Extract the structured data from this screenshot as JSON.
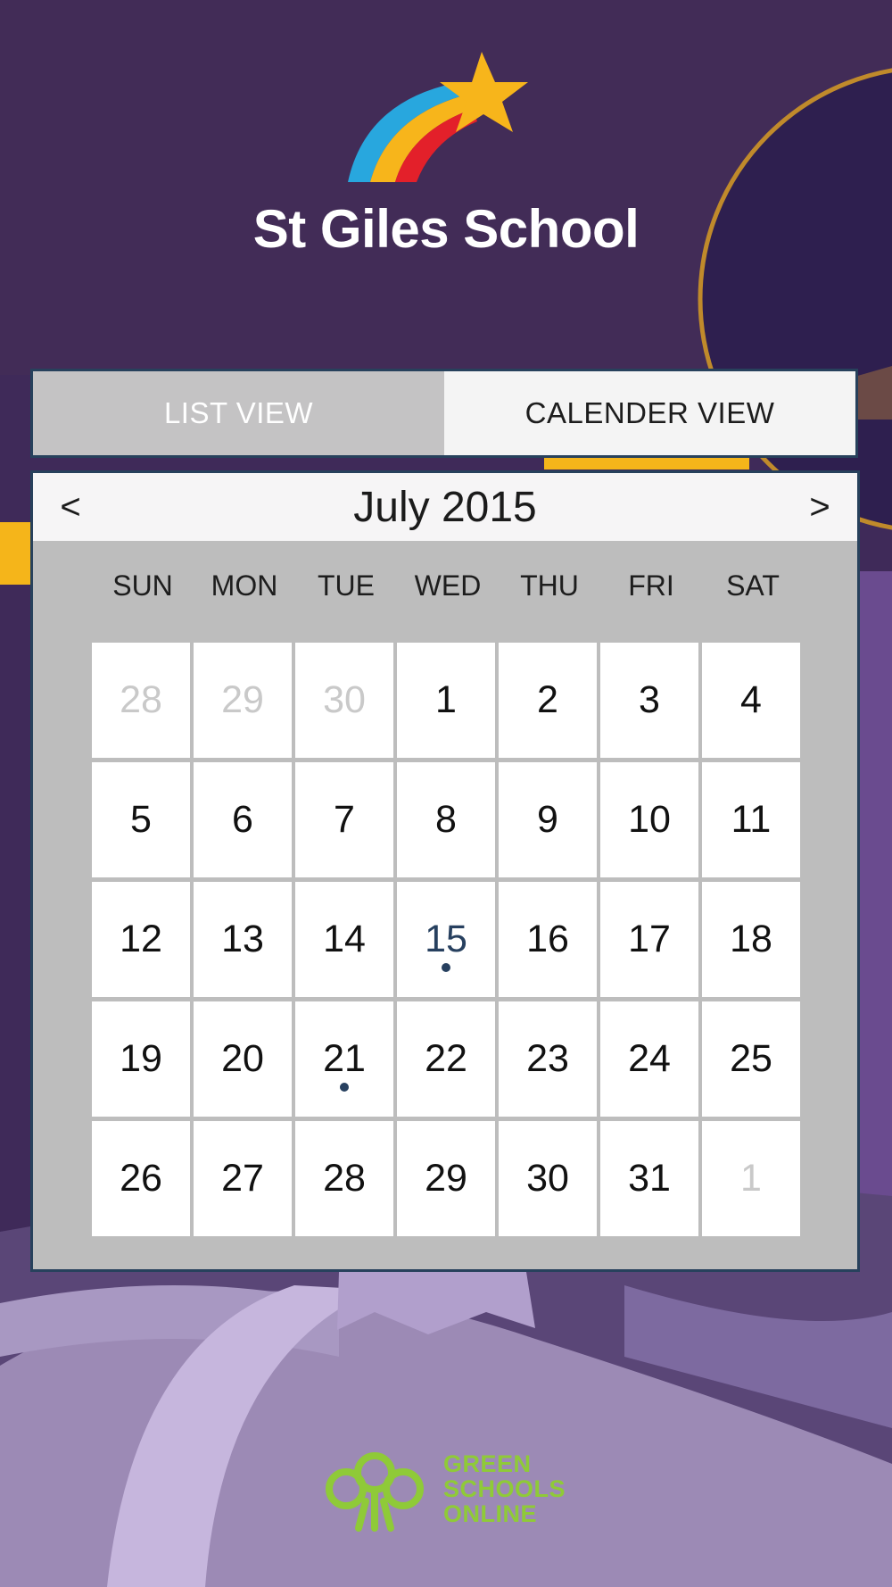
{
  "header": {
    "school_name": "St Giles School"
  },
  "tabs": {
    "list_view": "LIST VIEW",
    "calendar_view": "CALENDER VIEW",
    "active": "calendar_view"
  },
  "calendar": {
    "month_label": "July 2015",
    "prev": "<",
    "next": ">",
    "weekdays": [
      "SUN",
      "MON",
      "TUE",
      "WED",
      "THU",
      "FRI",
      "SAT"
    ],
    "days": [
      {
        "label": "28",
        "muted": true
      },
      {
        "label": "29",
        "muted": true
      },
      {
        "label": "30",
        "muted": true
      },
      {
        "label": "1"
      },
      {
        "label": "2"
      },
      {
        "label": "3"
      },
      {
        "label": "4"
      },
      {
        "label": "5"
      },
      {
        "label": "6"
      },
      {
        "label": "7"
      },
      {
        "label": "8"
      },
      {
        "label": "9"
      },
      {
        "label": "10"
      },
      {
        "label": "11"
      },
      {
        "label": "12"
      },
      {
        "label": "13"
      },
      {
        "label": "14"
      },
      {
        "label": "15",
        "today": true,
        "event": true
      },
      {
        "label": "16"
      },
      {
        "label": "17"
      },
      {
        "label": "18"
      },
      {
        "label": "19"
      },
      {
        "label": "20"
      },
      {
        "label": "21",
        "event": true
      },
      {
        "label": "22"
      },
      {
        "label": "23"
      },
      {
        "label": "24"
      },
      {
        "label": "25"
      },
      {
        "label": "26"
      },
      {
        "label": "27"
      },
      {
        "label": "28"
      },
      {
        "label": "29"
      },
      {
        "label": "30"
      },
      {
        "label": "31"
      },
      {
        "label": "1",
        "muted": true
      }
    ]
  },
  "footer": {
    "brand_lines": [
      "GREEN",
      "SCHOOLS",
      "ONLINE"
    ]
  },
  "colors": {
    "background": "#3f2a59",
    "border": "#27415c",
    "brand_green": "#8fca38",
    "event_dot": "#27405f"
  },
  "icons": {
    "logo": "shooting-star-rainbow-icon",
    "brand": "tree-icon"
  }
}
